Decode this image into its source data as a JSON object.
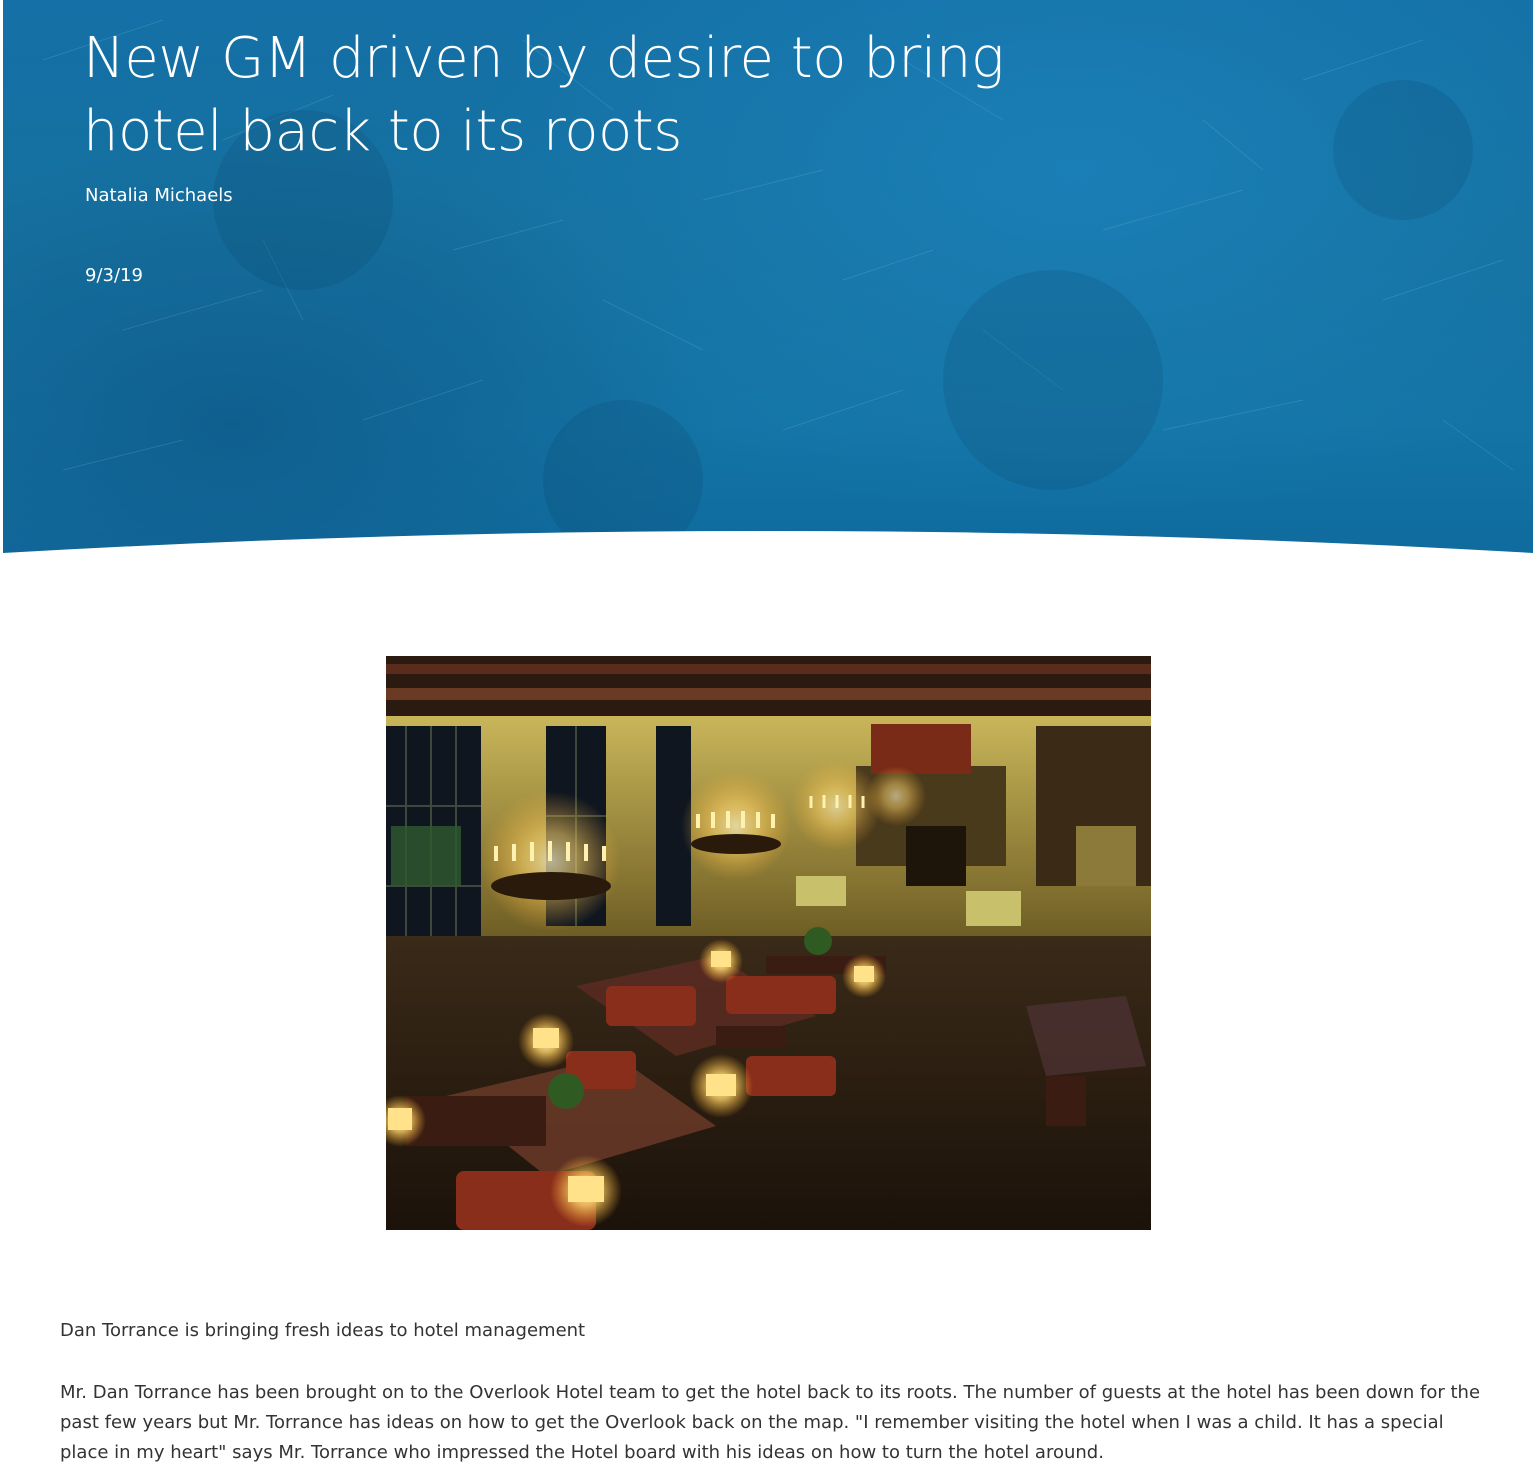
{
  "article": {
    "title": "New GM driven by desire to bring hotel back to its roots",
    "author": "Natalia Michaels",
    "date": "9/3/19",
    "subheading": "Dan Torrance is bringing fresh ideas to hotel management",
    "body": "Mr. Dan Torrance has been brought on to the Overlook Hotel team to get the hotel back to its roots. The number of guests at the hotel has been down for the past few years but Mr. Torrance has ideas on how to get the Overlook back on the map. \"I remember visiting the hotel when I was a child. It has a special place in my heart\" says Mr. Torrance who impressed the Hotel board with his ideas on how to turn the hotel around."
  },
  "hero": {
    "background_color": "#1470a6"
  },
  "image": {
    "subject": "hotel-lobby-photo"
  }
}
